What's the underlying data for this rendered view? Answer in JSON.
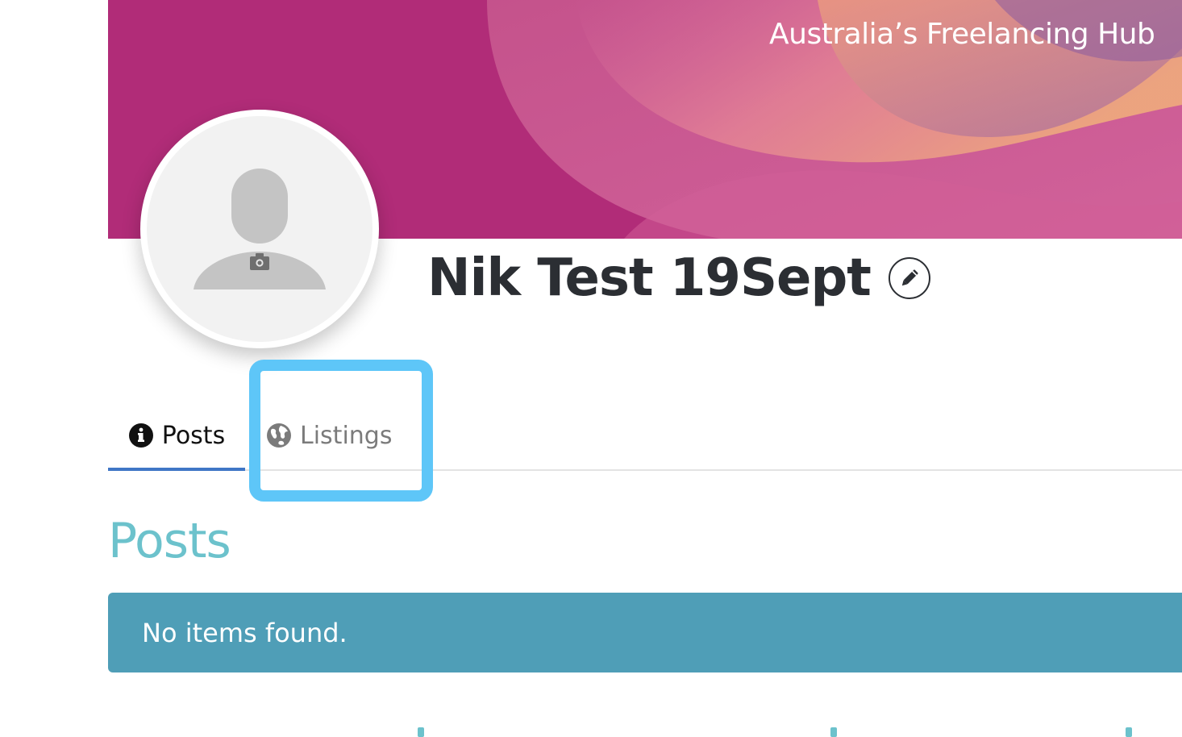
{
  "cover": {
    "tagline": "Australia’s Freelancing Hub",
    "colors": {
      "base": "#b12c78",
      "warm": "#e9a27d",
      "violet": "#8a5ba0"
    }
  },
  "avatar": {
    "placeholder_icon": "user-silhouette-icon",
    "upload_icon": "camera-icon"
  },
  "profile": {
    "name": "Nik Test 19Sept",
    "edit_icon": "pencil-icon"
  },
  "tabs": [
    {
      "label": "Posts",
      "icon": "info-circle-icon",
      "active": true
    },
    {
      "label": "Listings",
      "icon": "globe-icon",
      "active": false,
      "highlighted": true
    }
  ],
  "posts_section": {
    "title": "Posts",
    "empty_message": "No items found."
  },
  "colors": {
    "heading_text": "#2b2e33",
    "accent_teal": "#6cc2cc",
    "alert_bg": "#4f9eb7",
    "active_tab_underline": "#3f76c6",
    "highlight_outline": "#5ec6f8"
  }
}
